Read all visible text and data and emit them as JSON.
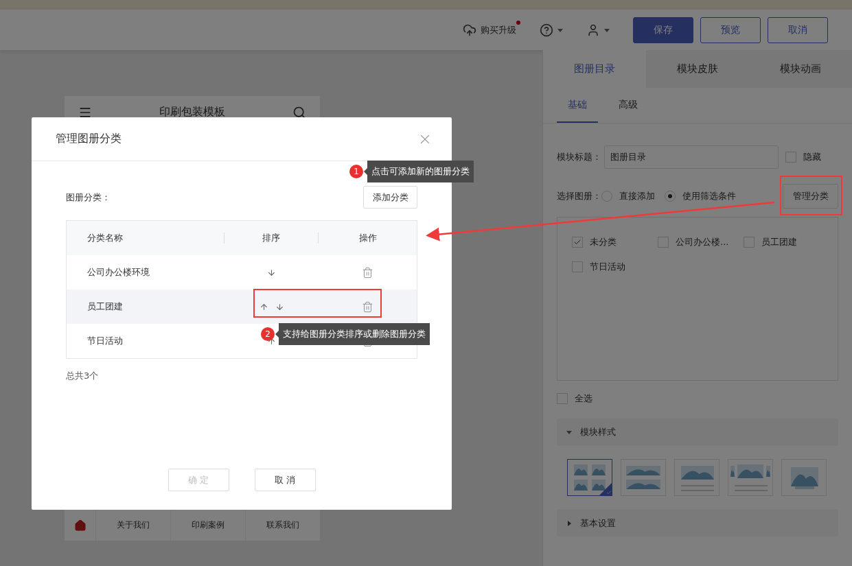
{
  "topbar": {
    "upgrade": {
      "label": "购买升级",
      "badge": true
    },
    "buttons": [
      {
        "label": "保存",
        "kind": "primary"
      },
      {
        "label": "预览",
        "kind": "outline"
      },
      {
        "label": "取消",
        "kind": "outline"
      }
    ]
  },
  "preview": {
    "title": "印刷包装模板",
    "nav": [
      "关于我们",
      "印刷案例",
      "联系我们"
    ]
  },
  "panel": {
    "tabs": [
      {
        "label": "图册目录",
        "selected": true
      },
      {
        "label": "模块皮肤",
        "selected": false
      },
      {
        "label": "模块动画",
        "selected": false
      }
    ],
    "subtabs": [
      {
        "label": "基础",
        "selected": true
      },
      {
        "label": "高级",
        "selected": false
      }
    ],
    "title_label": "模块标题：",
    "title_value": "图册目录",
    "hide": {
      "label": "隐藏",
      "checked": false
    },
    "select_label": "选择图册：",
    "radios": [
      {
        "label": "直接添加",
        "selected": false
      },
      {
        "label": "使用筛选条件",
        "selected": true
      }
    ],
    "manage_button": "管理分类",
    "categories": [
      {
        "label": "未分类",
        "checked": true
      },
      {
        "label": "公司办公楼...",
        "checked": false
      },
      {
        "label": "员工团建",
        "checked": false
      },
      {
        "label": "节日活动",
        "checked": false
      }
    ],
    "select_all": {
      "label": "全选",
      "checked": false
    },
    "sections": [
      {
        "label": "模块样式",
        "expanded": true
      },
      {
        "label": "基本设置",
        "expanded": false
      }
    ],
    "styles": [
      {
        "kind": "grid",
        "selected": true
      },
      {
        "kind": "rows",
        "selected": false
      },
      {
        "kind": "banner",
        "selected": false
      },
      {
        "kind": "carousel",
        "selected": false
      },
      {
        "kind": "single",
        "selected": false
      }
    ]
  },
  "modal": {
    "title": "管理图册分类",
    "label": "图册分类：",
    "add_button": "添加分类",
    "columns": [
      "分类名称",
      "排序",
      "操作"
    ],
    "rows": [
      {
        "name": "公司办公楼环境",
        "up": false,
        "down": true,
        "highlighted": false
      },
      {
        "name": "员工团建",
        "up": true,
        "down": true,
        "highlighted": true
      },
      {
        "name": "节日活动",
        "up": true,
        "down": false,
        "highlighted": false
      }
    ],
    "total": "总共3个",
    "confirm": {
      "label": "确 定",
      "disabled": true
    },
    "cancel": "取 消"
  },
  "annotations": [
    {
      "number": "1",
      "text": "点击可添加新的图册分类"
    },
    {
      "number": "2",
      "text": "支持给图册分类排序或删除图册分类"
    }
  ]
}
